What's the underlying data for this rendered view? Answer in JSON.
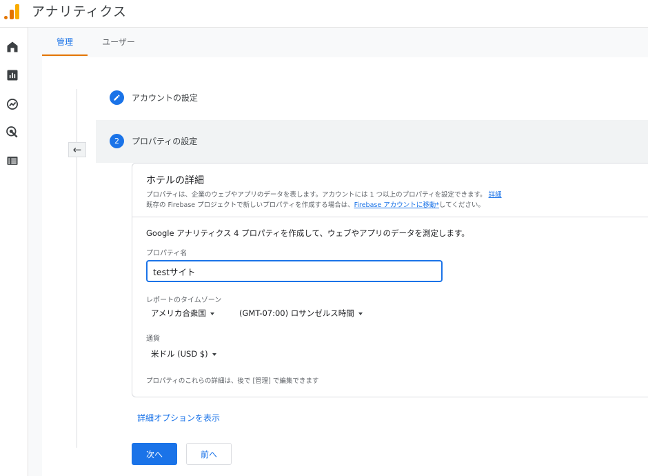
{
  "header": {
    "app_title": "アナリティクス",
    "logo_icon": "analytics-logo-icon"
  },
  "leftnav": {
    "icons": [
      "home-icon",
      "reports-icon",
      "explore-icon",
      "advertising-icon",
      "configure-icon"
    ]
  },
  "tabs": [
    {
      "label": "管理",
      "active": true
    },
    {
      "label": "ユーザー",
      "active": false
    }
  ],
  "steps": {
    "step1": {
      "icon": "pencil-icon",
      "label": "アカウントの設定"
    },
    "step2": {
      "number": "2",
      "label": "プロパティの設定"
    }
  },
  "card": {
    "title": "ホテルの詳細",
    "desc_line1": "プロパティは、企業のウェブやアプリのデータを表します。アカウントには 1 つ以上のプロパティを設定できます。",
    "desc_line1_link": "詳細",
    "desc_line2_pre": "既存の Firebase プロジェクトで新しいプロパティを作成する場合は、",
    "desc_line2_link": "Firebase アカウントに移動*",
    "desc_line2_post": "してください。",
    "intro": "Google アナリティクス 4 プロパティを作成して、ウェブやアプリのデータを測定します。",
    "property_name_label": "プロパティ名",
    "property_name_value": "testサイト",
    "timezone_label": "レポートのタイムゾーン",
    "country_value": "アメリカ合衆国",
    "timezone_value": "(GMT-07:00) ロサンゼルス時間",
    "currency_label": "通貨",
    "currency_value": "米ドル (USD $)",
    "note": "プロパティのこれらの詳細は、後で [管理] で編集できます"
  },
  "advanced_link": "詳細オプションを表示",
  "buttons": {
    "next": "次へ",
    "prev": "前へ"
  },
  "colors": {
    "accent": "#1a73e8",
    "tab_indicator": "#e37400",
    "logo": "#f9ab00"
  }
}
